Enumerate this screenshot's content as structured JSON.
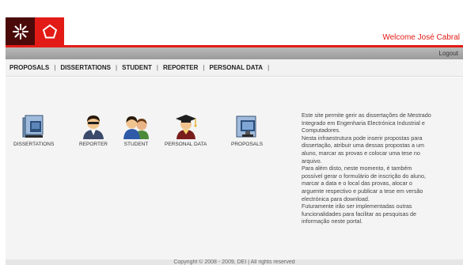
{
  "header": {
    "welcome_text": "Welcome José Cabral"
  },
  "toolbar": {
    "logout_label": "Logout"
  },
  "menu": {
    "items": [
      {
        "label": "PROPOSALS"
      },
      {
        "label": "DISSERTATIONS"
      },
      {
        "label": "STUDENT"
      },
      {
        "label": "REPORTER"
      },
      {
        "label": "PERSONAL DATA"
      }
    ]
  },
  "shortcuts": [
    {
      "label": "DISSERTATIONS",
      "icon": "dissertations-icon"
    },
    {
      "label": "REPORTER",
      "icon": "reporter-icon"
    },
    {
      "label": "STUDENT",
      "icon": "student-icon"
    },
    {
      "label": "PERSONAL DATA",
      "icon": "personal-data-icon"
    },
    {
      "label": "PROPOSALS",
      "icon": "proposals-icon"
    }
  ],
  "description": {
    "lines": [
      "Este site permite gerir as dissertações de Mestrado",
      "Integrado em Engenharia Electrónica Industrial e",
      "Computadores.",
      "Nesta infraestrutura pode inserir propostas para",
      "dissertação, atribuir uma dessas propostas a um",
      "aluno, marcar as provas e colocar uma tese no",
      "arquivo.",
      "Para além disto, neste momento, é também",
      "possível gerar o formulário de inscrição do aluno,",
      "marcar a data e o local das provas, alocar o",
      "arguente respectivo e publicar a tese em versão",
      "electrónica para download.",
      "Futuramente irão ser implementadas outras",
      "funcionalidades para facilitar as pesquisas de",
      "informação neste portal."
    ]
  },
  "footer": {
    "text": "Copyright © 2008 - 2009, DEI | All rights reserved"
  },
  "colors": {
    "brand_red": "#e31b16",
    "brand_dark": "#4a0a0a"
  }
}
